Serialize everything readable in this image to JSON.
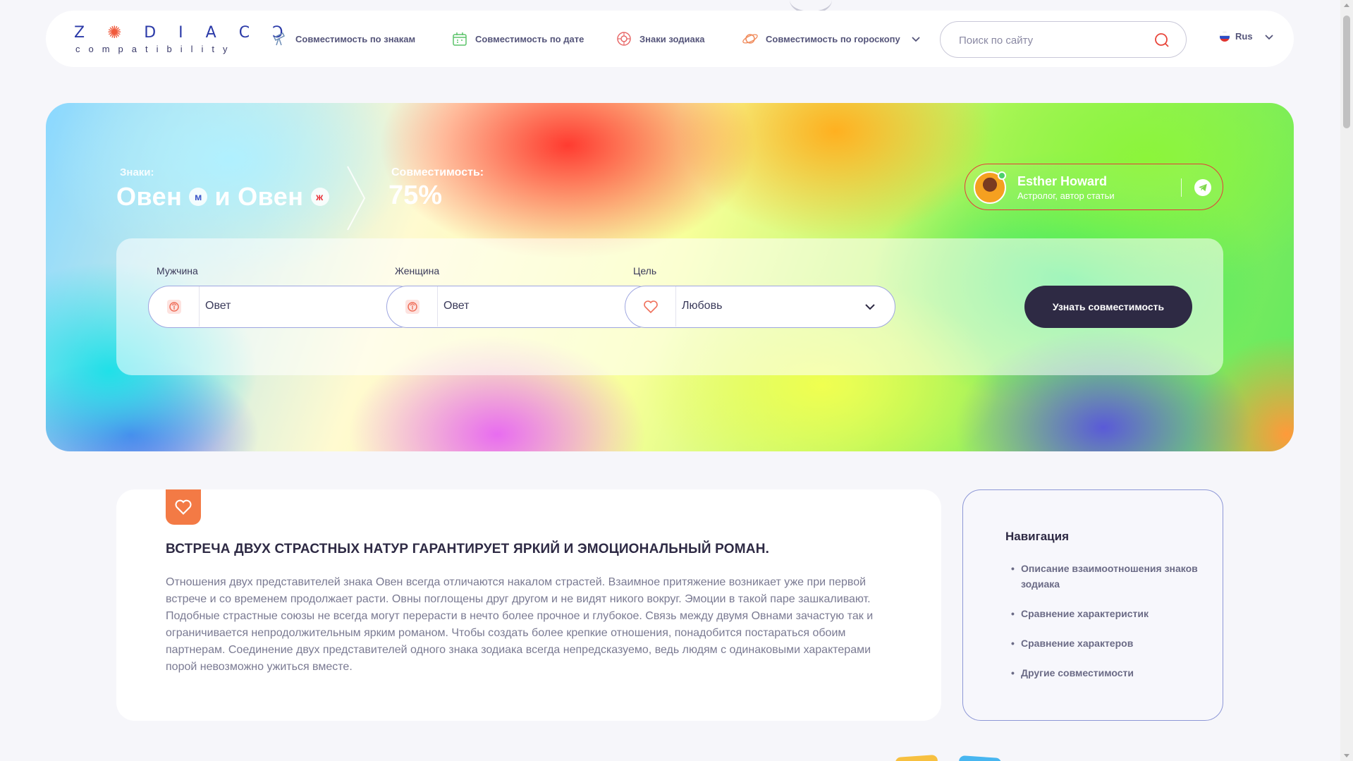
{
  "logo": {
    "wordmark": "ZODIACS",
    "tagline": "compatibility"
  },
  "nav": {
    "items": [
      {
        "label": "Совместимость по знакам",
        "icon": "telescope-icon"
      },
      {
        "label": "Совместимость по дате",
        "icon": "calendar-icon"
      },
      {
        "label": "Знаки зодиака",
        "icon": "zodiac-wheel-icon"
      },
      {
        "label": "Совместимость по гороскопу",
        "icon": "planet-icon",
        "has_dropdown": true
      }
    ]
  },
  "search": {
    "placeholder": "Поиск по сайту",
    "value": ""
  },
  "language": {
    "selected": "Rus",
    "flag": "russia-flag-icon"
  },
  "hero": {
    "signs_label": "Знаки:",
    "sign_male": "Овен",
    "sign_female": "Овен",
    "conjunction": "и",
    "male_badge": "м",
    "female_badge": "ж",
    "compat_label": "Совместимость:",
    "compat_value": "75%",
    "compat_percent": 75
  },
  "author": {
    "name": "Esther Howard",
    "role": "Астролог, автор статьи",
    "online": true
  },
  "form": {
    "man": {
      "label": "Мужчина",
      "value": "Овет"
    },
    "woman": {
      "label": "Женщина",
      "value": "Овет"
    },
    "goal": {
      "label": "Цель",
      "value": "Любовь"
    },
    "submit_label": "Узнать совместимость"
  },
  "article": {
    "title": "ВСТРЕЧА ДВУХ СТРАСТНЫХ НАТУР ГАРАНТИРУЕТ ЯРКИЙ И ЭМОЦИОНАЛЬНЫЙ РОМАН.",
    "body": "Отношения двух представителей знака Овен всегда отличаются накалом страстей. Взаимное притяжение возникает уже при первой встрече и со временем продолжает расти. Овны поглощены друг другом и не видят никого вокруг. Эмоции в такой паре зашкаливают. Подобные страстные союзы не всегда могут перерасти в нечто более прочное и глубокое. Связь между двумя Овнами зачастую так и ограничивается непродолжительным ярким романом. Чтобы создать более крепкие отношения, понадобится постараться обоим партнерам. Соединение двух представителей одного знака зодиака всегда непредсказуемо, ведь людям с одинаковыми характерами порой невозможно ужиться вместе."
  },
  "navigation": {
    "title": "Навигация",
    "items": [
      {
        "label": "Описание взаимоотношения знаков зодиака"
      },
      {
        "label": "Сравнение характеристик"
      },
      {
        "label": "Сравнение характеров"
      },
      {
        "label": "Другие совместимости"
      }
    ]
  },
  "colors": {
    "accent_dark": "#2e2a44",
    "accent_orange": "#f37a45",
    "author_border": "#e53a3a",
    "select_border": "#9ea6e0",
    "nav_border": "#8d97d6",
    "logo_blue": "#2b3aa8",
    "logo_sun": "#f05a3c"
  }
}
